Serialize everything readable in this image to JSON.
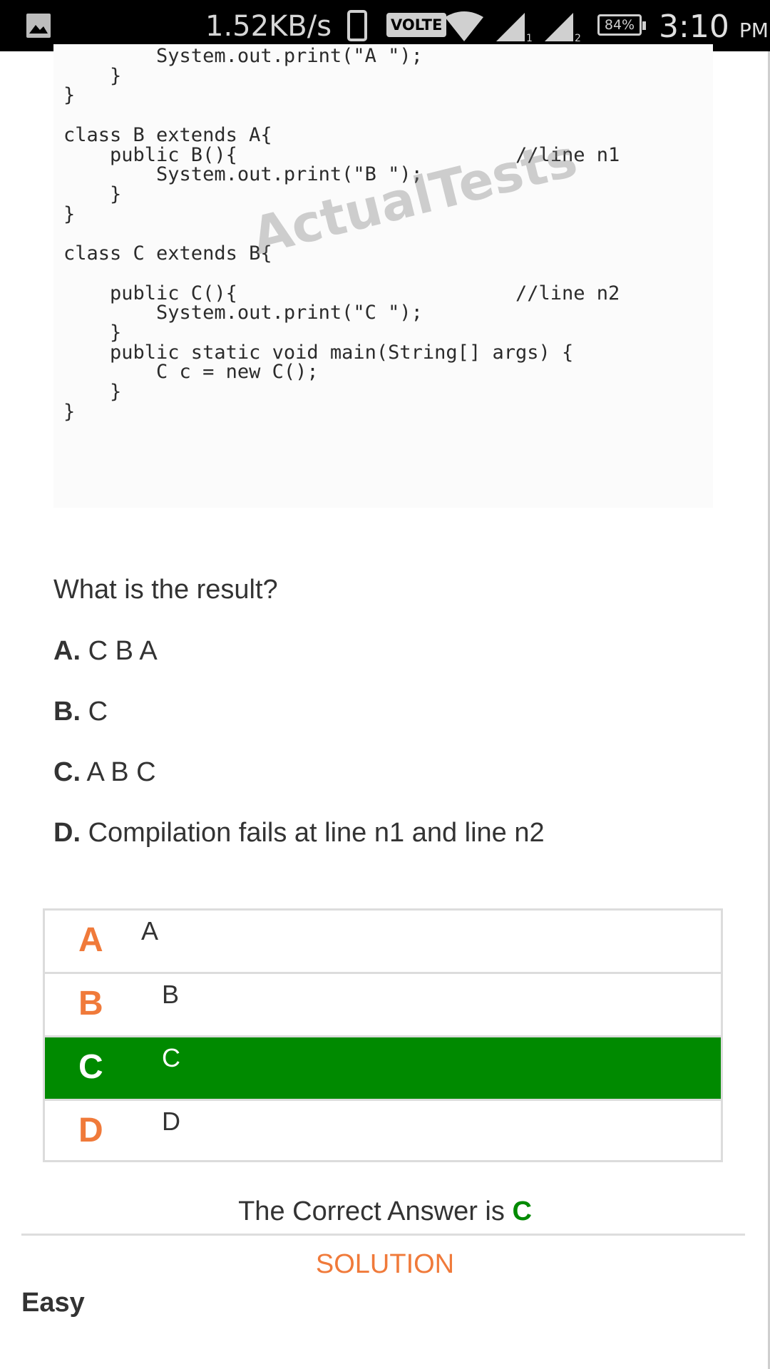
{
  "status_bar": {
    "net_speed": "1.52KB/s",
    "volte": "VOLTE",
    "sim1": "1",
    "sim2": "2",
    "battery": "84%",
    "time": "3:10",
    "ampm": "PM",
    "icons": [
      "gallery-icon",
      "phone-icon",
      "wifi-icon",
      "signal-icon",
      "signal-icon"
    ]
  },
  "code": {
    "lines": [
      "        System.out.print(\"A \");",
      "    }",
      "}",
      "",
      "class B extends A{",
      "    public B(){                        //line n1",
      "        System.out.print(\"B \");",
      "    }",
      "}",
      "",
      "class C extends B{",
      "",
      "    public C(){                        //line n2",
      "        System.out.print(\"C \");",
      "    }",
      "    public static void main(String[] args) {",
      "        C c = new C();",
      "    }",
      "}"
    ],
    "watermark": "ActualTests"
  },
  "question": "What is the result?",
  "options": [
    {
      "letter": "A.",
      "text": "C B A"
    },
    {
      "letter": "B.",
      "text": "C"
    },
    {
      "letter": "C.",
      "text": "A B C"
    },
    {
      "letter": "D.",
      "text": "Compilation fails at line n1 and line n2"
    }
  ],
  "answers": [
    {
      "letter": "A",
      "text": "A",
      "selected": false
    },
    {
      "letter": "B",
      "text": "B",
      "selected": false
    },
    {
      "letter": "C",
      "text": "C",
      "selected": true
    },
    {
      "letter": "D",
      "text": "D",
      "selected": false
    }
  ],
  "correct_answer": {
    "prefix": "The Correct Answer is ",
    "letter": "C"
  },
  "solution_label": "SOLUTION",
  "difficulty": "Easy",
  "colors": {
    "accent": "#f07a3a",
    "correct": "#008a00"
  }
}
